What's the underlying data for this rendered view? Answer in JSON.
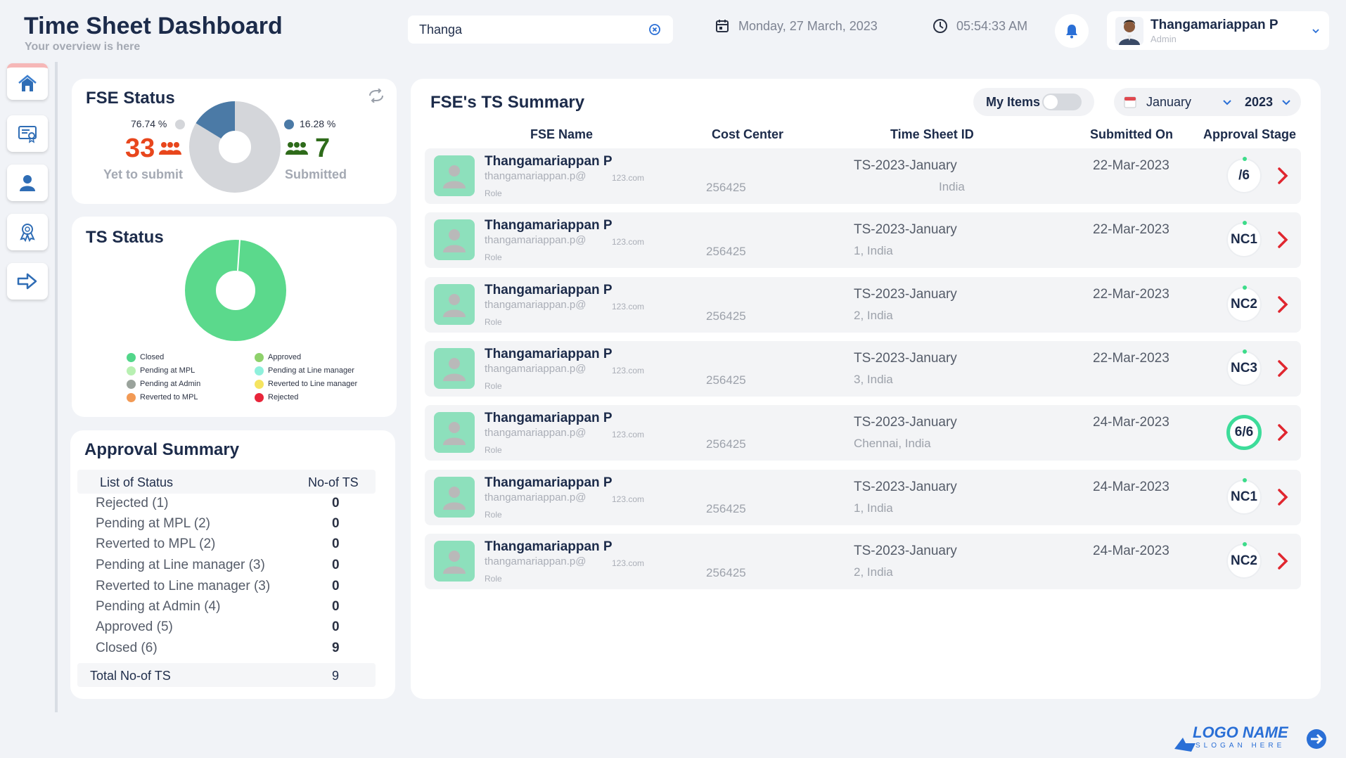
{
  "header": {
    "title": "Time Sheet Dashboard",
    "subtitle": "Your overview is here",
    "search_value": "Thanga",
    "date": "Monday,  27 March, 2023",
    "time": "05:54:33 AM",
    "user_name": "Thangamariappan P",
    "user_role": "Admin"
  },
  "sidebar": {
    "items": [
      "home-icon",
      "certificate-icon",
      "user-icon",
      "award-icon",
      "logout-arrow-icon"
    ]
  },
  "fse_status": {
    "title": "FSE Status",
    "yet_pct": "76.74 %",
    "yet_count": "33",
    "yet_label": "Yet to submit",
    "sub_pct": "16.28 %",
    "sub_count": "7",
    "sub_label": "Submitted",
    "colors": {
      "yet": "#d4d6da",
      "submitted": "#4b7aa6",
      "yet_count": "#e8461c",
      "sub_count": "#2e6b1a"
    }
  },
  "ts_status": {
    "title": "TS Status",
    "legend": [
      {
        "label": "Closed",
        "color": "#52d68a"
      },
      {
        "label": "Approved",
        "color": "#8ed16b"
      },
      {
        "label": "Pending at MPL",
        "color": "#b8f0b2"
      },
      {
        "label": "Pending at Line manager",
        "color": "#8ff0dc"
      },
      {
        "label": "Pending at Admin",
        "color": "#9aa39c"
      },
      {
        "label": "Reverted to Line manager",
        "color": "#f5e460"
      },
      {
        "label": "Reverted to MPL",
        "color": "#f29a55"
      },
      {
        "label": "Rejected",
        "color": "#e8253a"
      }
    ]
  },
  "approval_summary": {
    "title": "Approval Summary",
    "col_status": "List of Status",
    "col_count": "No-of TS",
    "rows": [
      {
        "label": "Rejected (1)",
        "count": "0"
      },
      {
        "label": "Pending at MPL (2)",
        "count": "0"
      },
      {
        "label": "Reverted to MPL (2)",
        "count": "0"
      },
      {
        "label": "Pending at Line manager (3)",
        "count": "0"
      },
      {
        "label": "Reverted to Line manager (3)",
        "count": "0"
      },
      {
        "label": "Pending at Admin (4)",
        "count": "0"
      },
      {
        "label": "Approved (5)",
        "count": "0"
      },
      {
        "label": "Closed (6)",
        "count": "9"
      }
    ],
    "total_label": "Total No-of TS",
    "total_count": "9"
  },
  "summary": {
    "title": "FSE's TS Summary",
    "my_items_label": "My Items",
    "month": "January",
    "year": "2023",
    "columns": [
      "FSE Name",
      "Cost Center",
      "Time Sheet ID",
      "Submitted On",
      "Approval Stage"
    ],
    "rows": [
      {
        "name": "Thangamariappan P",
        "email": "thangamariappan.p@",
        "domain": "123.com",
        "role": "Role",
        "cost_center": "256425",
        "ts_id": "TS-2023-January",
        "location": "India",
        "submitted": "22-Mar-2023",
        "stage": "/6"
      },
      {
        "name": "Thangamariappan P",
        "email": "thangamariappan.p@",
        "domain": "123.com",
        "role": "Role",
        "cost_center": "256425",
        "ts_id": "TS-2023-January",
        "location": "1, India",
        "submitted": "22-Mar-2023",
        "stage": "NC1"
      },
      {
        "name": "Thangamariappan P",
        "email": "thangamariappan.p@",
        "domain": "123.com",
        "role": "Role",
        "cost_center": "256425",
        "ts_id": "TS-2023-January",
        "location": "2, India",
        "submitted": "22-Mar-2023",
        "stage": "NC2"
      },
      {
        "name": "Thangamariappan P",
        "email": "thangamariappan.p@",
        "domain": "123.com",
        "role": "Role",
        "cost_center": "256425",
        "ts_id": "TS-2023-January",
        "location": "3, India",
        "submitted": "22-Mar-2023",
        "stage": "NC3"
      },
      {
        "name": "Thangamariappan P",
        "email": "thangamariappan.p@",
        "domain": "123.com",
        "role": "Role",
        "cost_center": "256425",
        "ts_id": "TS-2023-January",
        "location": "Chennai, India",
        "submitted": "24-Mar-2023",
        "stage": "6/6"
      },
      {
        "name": "Thangamariappan P",
        "email": "thangamariappan.p@",
        "domain": "123.com",
        "role": "Role",
        "cost_center": "256425",
        "ts_id": "TS-2023-January",
        "location": "1, India",
        "submitted": "24-Mar-2023",
        "stage": "NC1"
      },
      {
        "name": "Thangamariappan P",
        "email": "thangamariappan.p@",
        "domain": "123.com",
        "role": "Role",
        "cost_center": "256425",
        "ts_id": "TS-2023-January",
        "location": "2, India",
        "submitted": "24-Mar-2023",
        "stage": "NC2"
      }
    ]
  },
  "logo": {
    "name": "LOGO NAME",
    "slogan": "SLOGAN HERE"
  }
}
